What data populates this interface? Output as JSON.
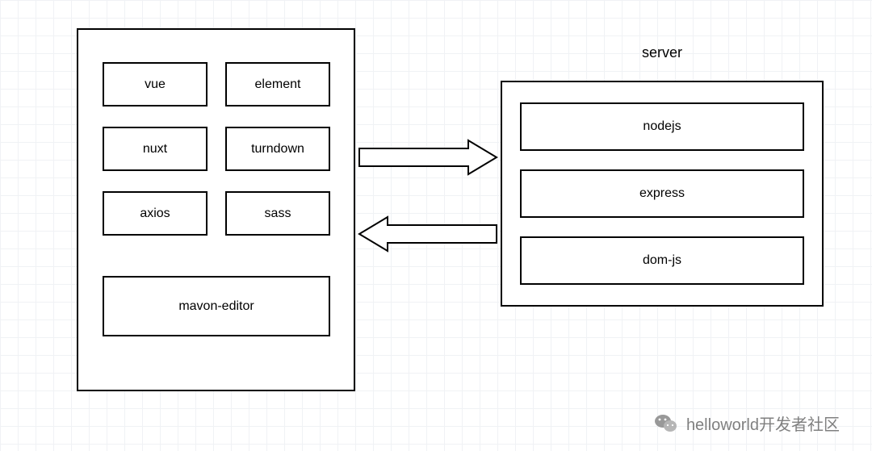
{
  "client": {
    "items": [
      "vue",
      "element",
      "nuxt",
      "turndown",
      "axios",
      "sass"
    ],
    "wide_item": "mavon-editor"
  },
  "server": {
    "label": "server",
    "items": [
      "nodejs",
      "express",
      "dom-js"
    ]
  },
  "watermark": {
    "text": "helloworld开发者社区"
  }
}
